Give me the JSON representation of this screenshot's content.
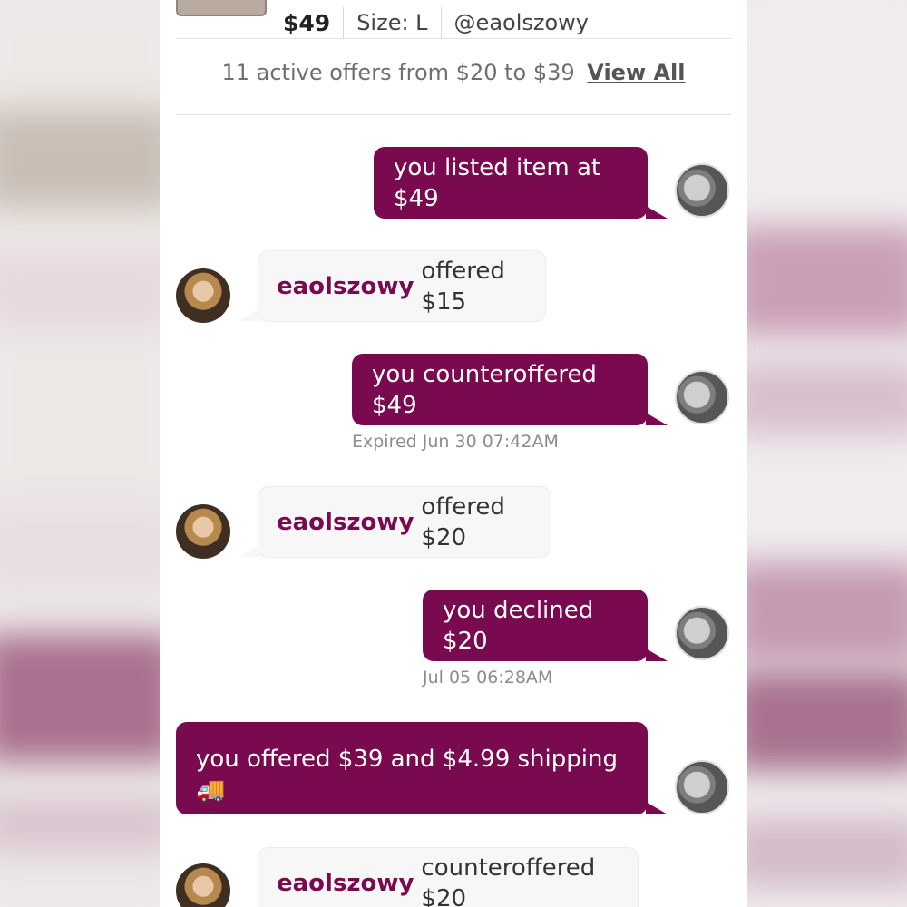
{
  "listing": {
    "price": "$49",
    "size": "Size: L",
    "seller": "@eaolszowy",
    "offers_summary": "11 active offers from $20 to $39",
    "view_all": "View All"
  },
  "messages": [
    {
      "text": "you listed item at $49"
    },
    {
      "user": "eaolszowy",
      "text": "offered $15"
    },
    {
      "text": "you counteroffered $49",
      "timestamp": "Expired Jun 30 07:42AM"
    },
    {
      "user": "eaolszowy",
      "text": "offered $20"
    },
    {
      "text": "you declined $20",
      "timestamp": "Jul 05 06:28AM"
    },
    {
      "text": "you offered $39 and $4.99 shipping",
      "emoji": "🚚"
    },
    {
      "user": "eaolszowy",
      "text": "counteroffered $20"
    }
  ],
  "colors": {
    "accent": "#7a0a4f",
    "them_bubble": "#f7f7f7"
  }
}
